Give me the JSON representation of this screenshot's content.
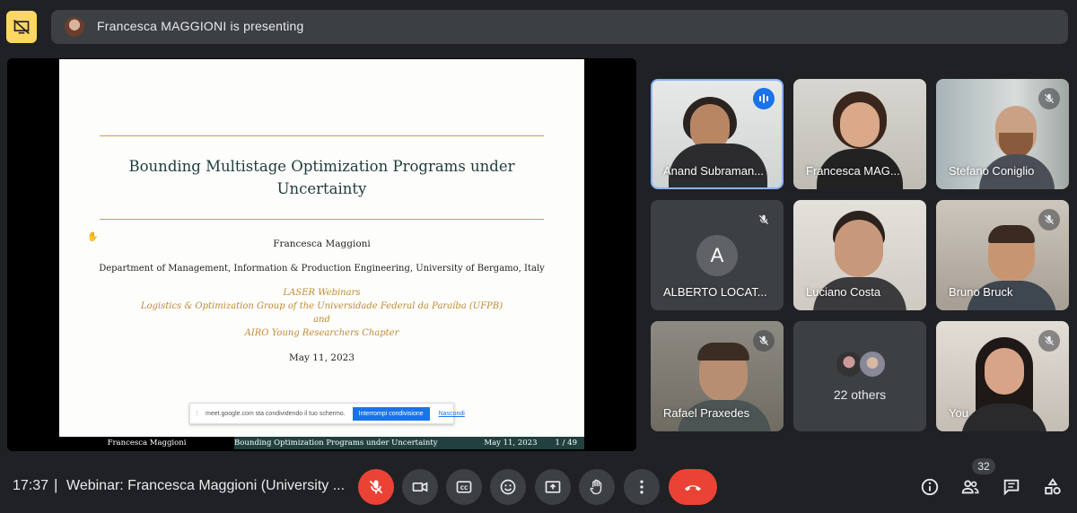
{
  "banner": {
    "text": "Francesca MAGGIONI is presenting"
  },
  "slide": {
    "title_line1": "Bounding Multistage Optimization Programs under",
    "title_line2": "Uncertainty",
    "author": "Francesca Maggioni",
    "affiliation": "Department of Management, Information & Production Engineering, University of Bergamo, Italy",
    "event_line1": "LASER Webinars",
    "event_line2": "Logistics & Optimization Group of the Universidade Federal da Paraíba (UFPB)",
    "event_line3": "and",
    "event_line4": "AIRO Young Researchers Chapter",
    "date": "May 11, 2023",
    "footer_author": "Francesca Maggioni",
    "footer_title": "Bounding Optimization Programs under Uncertainty",
    "footer_date": "May 11, 2023",
    "footer_page": "1 / 49"
  },
  "share_bar": {
    "message": "meet.google.com sta condividendo il tuo schermo.",
    "stop_label": "Interrompi condivisione",
    "hide_label": "Nascondi"
  },
  "participants": [
    {
      "name": "Anand Subraman...",
      "muted": false,
      "speaking": true
    },
    {
      "name": "Francesca MAG...",
      "muted": false
    },
    {
      "name": "Stefano Coniglio",
      "muted": true
    },
    {
      "name": "ALBERTO LOCAT...",
      "muted": true,
      "initial": "A",
      "avatar_color": "#5f6368"
    },
    {
      "name": "Luciano Costa",
      "muted": false
    },
    {
      "name": "Bruno Bruck",
      "muted": true
    },
    {
      "name": "Rafael Praxedes",
      "muted": true
    },
    {
      "name": "22 others"
    },
    {
      "name": "You",
      "muted": true
    }
  ],
  "footer": {
    "time": "17:37",
    "separator": "|",
    "meeting_title": "Webinar: Francesca Maggioni (University ...",
    "participant_count": "32"
  },
  "colors": {
    "end_call": "#ea4335",
    "mic_off": "#ea4335",
    "accent": "#8ab4f8",
    "banner_icon": "#fdd663"
  },
  "icons": [
    "stop-presenting-icon",
    "mic-off-icon",
    "camera-icon",
    "captions-icon",
    "emoji-icon",
    "present-icon",
    "raise-hand-icon",
    "more-options-icon",
    "end-call-icon",
    "info-icon",
    "people-icon",
    "chat-icon",
    "activities-icon",
    "speaking-icon"
  ]
}
